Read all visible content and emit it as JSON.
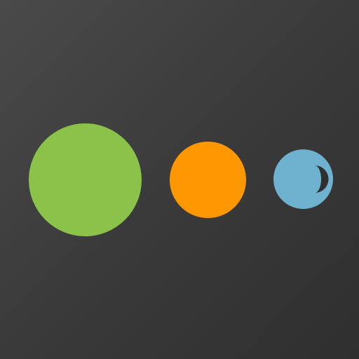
{
  "app_icon": {
    "background_color": "#3b3b3b",
    "dots": [
      {
        "name": "large-dot",
        "color": "#8bc34a"
      },
      {
        "name": "medium-dot",
        "color": "#ff9800"
      },
      {
        "name": "small-dot",
        "color": "#6eb2cf",
        "mark_color": "#2f2f2f"
      }
    ]
  }
}
